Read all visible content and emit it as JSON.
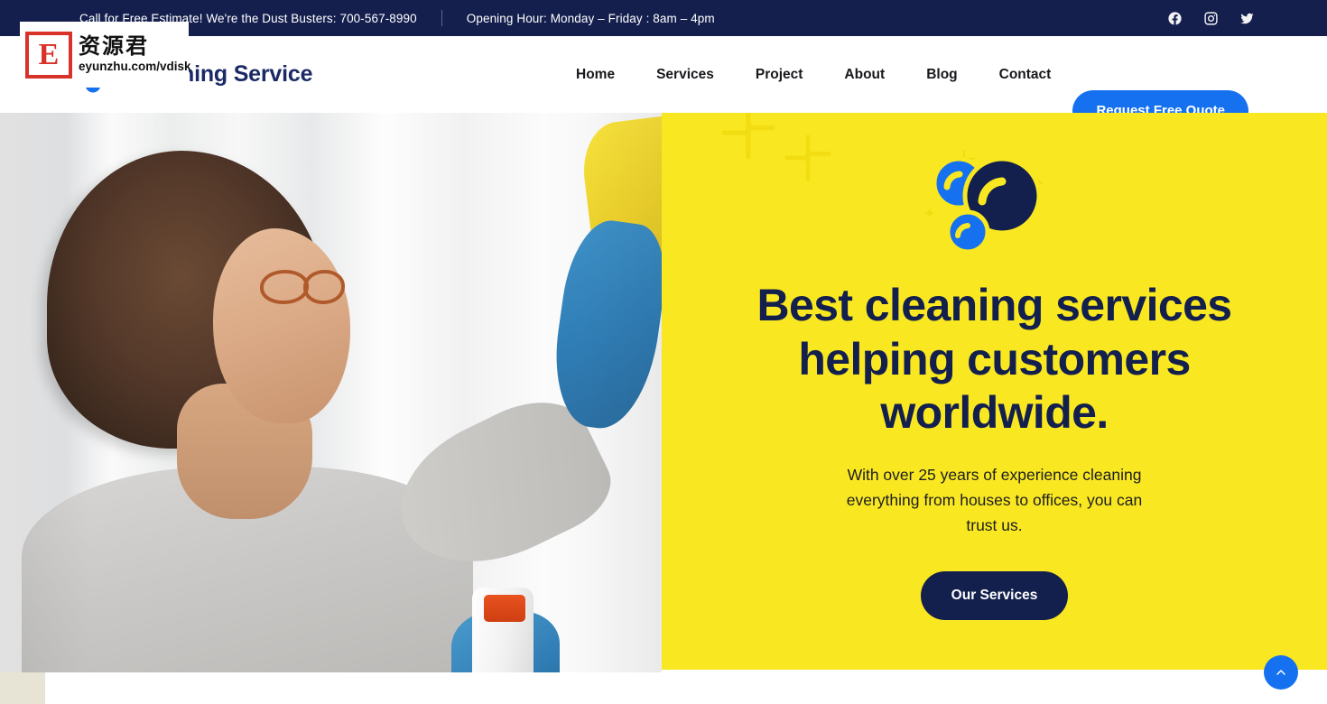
{
  "topbar": {
    "phone_text": "Call for Free Estimate! We're the Dust Busters: 700-567-8990",
    "hours_text": "Opening Hour: Monday – Friday : 8am – 4pm",
    "socials": [
      {
        "name": "facebook-icon",
        "label": "Facebook"
      },
      {
        "name": "instagram-icon",
        "label": "Instagram"
      },
      {
        "name": "twitter-icon",
        "label": "Twitter"
      }
    ],
    "background_color": "#141f4e"
  },
  "header": {
    "logo_text": "Cleaning Service",
    "logo_icon": "bubbles-icon",
    "nav": [
      {
        "label": "Home"
      },
      {
        "label": "Services"
      },
      {
        "label": "Project"
      },
      {
        "label": "About"
      },
      {
        "label": "Blog"
      },
      {
        "label": "Contact"
      }
    ],
    "cta_label": "Request Free Quote",
    "cta_color": "#1571f0"
  },
  "hero": {
    "image_alt": "Woman cleaning a window with a yellow cloth and blue gloves",
    "panel_color": "#f9e821",
    "bubbles_icon": "bubbles-icon",
    "title": "Best cleaning services helping customers worldwide.",
    "subtitle": "With over 25 years of experience cleaning everything from houses to offices, you can trust us.",
    "button_label": "Our Services",
    "button_color": "#131f4d",
    "title_color": "#131f4d"
  },
  "floating": {
    "scroll_top_icon": "chevron-up-icon",
    "scroll_top_color": "#1571f0"
  },
  "watermark": {
    "badge_letter": "E",
    "cn_text": "资源君",
    "url_text": "eyunzhu.com/vdisk"
  }
}
